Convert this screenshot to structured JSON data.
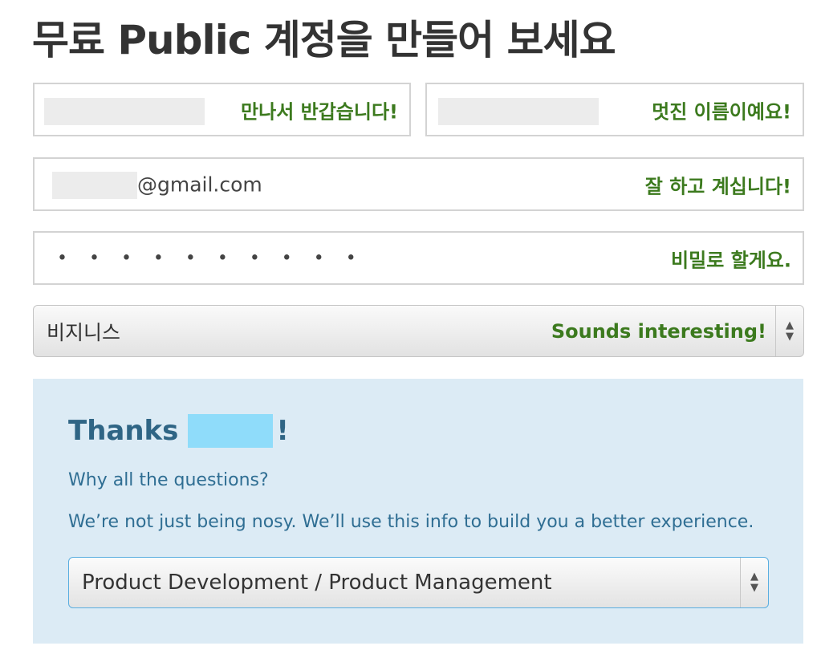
{
  "page": {
    "title": "무료 Public 계정을 만들어 보세요"
  },
  "form": {
    "first_name_hint": "만나서 반갑습니다!",
    "last_name_hint": "멋진 이름이예요!",
    "email_domain": "@gmail.com",
    "email_hint": "잘 하고 계십니다!",
    "password_mask": "• • • • • • • • • •",
    "password_hint": "비밀로 할게요.",
    "account_type_value": "비지니스",
    "account_type_hint": "Sounds interesting!"
  },
  "info": {
    "thanks_prefix": "Thanks",
    "thanks_suffix": "!",
    "question": "Why all the questions?",
    "explanation": "We’re not just being nosy. We’ll use this info to build you a better experience.",
    "role_value": "Product Development / Product Management"
  },
  "colors": {
    "hint_green": "#3c7a1e",
    "info_bg": "#dcebf5",
    "info_text": "#2f6e93"
  }
}
